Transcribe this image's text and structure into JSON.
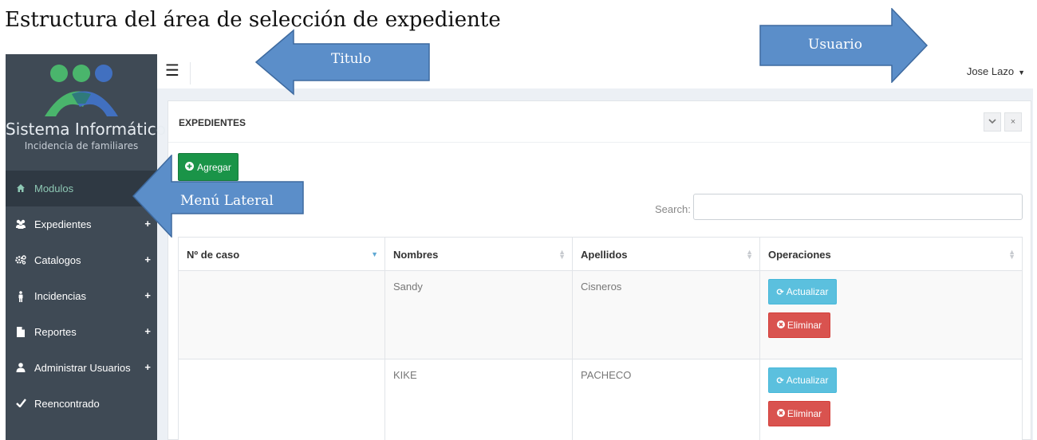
{
  "doc_title": "Estructura del área de selección de expediente",
  "sidebar": {
    "logo_title": "Sistema Informático",
    "logo_subtitle": "Incidencia de familiares",
    "items": [
      {
        "label": "Modulos",
        "icon": "home-icon",
        "expandable": false,
        "active": true
      },
      {
        "label": "Expedientes",
        "icon": "users-icon",
        "expandable": true
      },
      {
        "label": "Catalogos",
        "icon": "cogs-icon",
        "expandable": true
      },
      {
        "label": "Incidencias",
        "icon": "person-icon",
        "expandable": true
      },
      {
        "label": "Reportes",
        "icon": "file-icon",
        "expandable": true
      },
      {
        "label": "Administrar Usuarios",
        "icon": "user-icon",
        "expandable": true
      },
      {
        "label": "Reencontrado",
        "icon": "check-icon",
        "expandable": false
      }
    ],
    "expand_symbol": "+"
  },
  "topbar": {
    "menu_icon": "☰",
    "user_name": "Jose Lazo",
    "user_caret": "▼"
  },
  "panel": {
    "title": "EXPEDIENTES",
    "collapse_icon": "⌄",
    "close_icon": "×",
    "add_button": "Agregar",
    "search_label": "Search:",
    "search_value": "",
    "columns": [
      "Nº de caso",
      "Nombres",
      "Apellidos",
      "Operaciones"
    ],
    "rows": [
      {
        "caso": "",
        "nombres": "Sandy",
        "apellidos": "Cisneros",
        "update": "Actualizar",
        "delete": "Eliminar"
      },
      {
        "caso": "",
        "nombres": "KIKE",
        "apellidos": "PACHECO",
        "update": "Actualizar",
        "delete": "Eliminar"
      }
    ]
  },
  "annotations": {
    "titulo": "Titulo",
    "usuario": "Usuario",
    "menu_lateral": "Menú Lateral"
  },
  "colors": {
    "sidebar_bg": "#3f4a55",
    "annotation_fill": "#5b8ec9",
    "add_green": "#1a9448",
    "update_blue": "#5bc0de",
    "delete_red": "#d9534f",
    "logo_green": "#4ab56c",
    "logo_blue": "#4170c0"
  }
}
